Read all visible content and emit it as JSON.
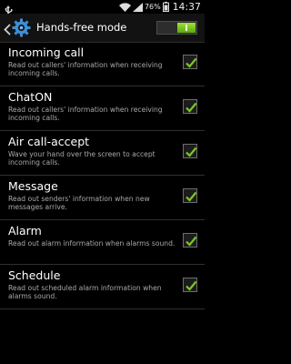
{
  "status_bar": {
    "battery_percent": "76%",
    "time": "14:37",
    "icons": [
      "usb-icon",
      "wifi-icon",
      "signal-icon",
      "battery-icon"
    ]
  },
  "action_bar": {
    "title": "Hands-free mode",
    "master_switch_on": true
  },
  "accent_color": "#7ec823",
  "items": [
    {
      "title": "Incoming call",
      "summary": "Read out callers' information when receiving incoming calls.",
      "checked": true
    },
    {
      "title": "ChatON",
      "summary": "Read out callers' information when receiving incoming calls.",
      "checked": true
    },
    {
      "title": "Air call-accept",
      "summary": "Wave your hand over the screen to accept incoming calls.",
      "checked": true
    },
    {
      "title": "Message",
      "summary": "Read out senders' information when new messages arrive.",
      "checked": true
    },
    {
      "title": "Alarm",
      "summary": "Read out alarm information when alarms sound.",
      "checked": true
    },
    {
      "title": "Schedule",
      "summary": "Read out scheduled alarm information when alarms sound.",
      "checked": true
    }
  ]
}
